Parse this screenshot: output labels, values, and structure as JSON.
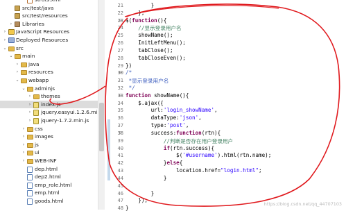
{
  "tree": {
    "items": [
      {
        "label": "struts.xml",
        "icon": "xml-file-icon",
        "indent": 3,
        "toggle": ""
      },
      {
        "label": "src/test/java",
        "icon": "package-folder-icon",
        "indent": 1,
        "toggle": ""
      },
      {
        "label": "src/test/resources",
        "icon": "package-folder-icon",
        "indent": 1,
        "toggle": ""
      },
      {
        "label": "Libraries",
        "icon": "library-icon",
        "indent": 1,
        "toggle": "›"
      },
      {
        "label": "JavaScript Resources",
        "icon": "javascript-resources-icon",
        "indent": 0,
        "toggle": "›"
      },
      {
        "label": "Deployed Resources",
        "icon": "deployed-resources-icon",
        "indent": 0,
        "toggle": "›"
      },
      {
        "label": "src",
        "icon": "folder-icon",
        "indent": 0,
        "toggle": "⌄"
      },
      {
        "label": "main",
        "icon": "folder-icon",
        "indent": 1,
        "toggle": "⌄"
      },
      {
        "label": "java",
        "icon": "folder-icon",
        "indent": 2,
        "toggle": "›"
      },
      {
        "label": "resources",
        "icon": "folder-icon",
        "indent": 2,
        "toggle": "›"
      },
      {
        "label": "webapp",
        "icon": "folder-icon",
        "indent": 2,
        "toggle": "⌄"
      },
      {
        "label": "adminjs",
        "icon": "folder-icon",
        "indent": 3,
        "toggle": "⌄"
      },
      {
        "label": "themes",
        "icon": "folder-icon",
        "indent": 4,
        "toggle": "›"
      },
      {
        "label": "index.js",
        "icon": "javascript-file-icon",
        "indent": 4,
        "toggle": "›",
        "selected": true
      },
      {
        "label": "jquery.easyui.1.2.6.min.js",
        "icon": "javascript-file-icon",
        "indent": 4,
        "toggle": "›"
      },
      {
        "label": "jquery-1.7.2.min.js",
        "icon": "javascript-file-icon",
        "indent": 4,
        "toggle": "›"
      },
      {
        "label": "css",
        "icon": "folder-icon",
        "indent": 3,
        "toggle": "›"
      },
      {
        "label": "images",
        "icon": "folder-icon",
        "indent": 3,
        "toggle": "›"
      },
      {
        "label": "js",
        "icon": "folder-icon",
        "indent": 3,
        "toggle": "›"
      },
      {
        "label": "ui",
        "icon": "folder-icon",
        "indent": 3,
        "toggle": "›"
      },
      {
        "label": "WEB-INF",
        "icon": "folder-icon",
        "indent": 3,
        "toggle": "›"
      },
      {
        "label": "dep.html",
        "icon": "html-file-icon",
        "indent": 3,
        "toggle": ""
      },
      {
        "label": "dep2.html",
        "icon": "html-file-icon",
        "indent": 3,
        "toggle": ""
      },
      {
        "label": "emp_role.html",
        "icon": "html-file-icon",
        "indent": 3,
        "toggle": ""
      },
      {
        "label": "emp.html",
        "icon": "html-file-icon",
        "indent": 3,
        "toggle": ""
      },
      {
        "label": "goods.html",
        "icon": "html-file-icon",
        "indent": 3,
        "toggle": ""
      }
    ]
  },
  "editor": {
    "lines": [
      {
        "n": "21",
        "fold": "",
        "tokens": [
          [
            "",
            "        }"
          ]
        ]
      },
      {
        "n": "22",
        "fold": "",
        "tokens": [
          [
            "",
            "    };"
          ]
        ]
      },
      {
        "n": "23",
        "fold": "⊖",
        "tokens": [
          [
            "",
            "$("
          ],
          [
            "kw",
            "function"
          ],
          [
            "",
            "(){"
          ]
        ]
      },
      {
        "n": "24",
        "fold": "",
        "tokens": [
          [
            "cm",
            "    //显示登录用户名"
          ]
        ]
      },
      {
        "n": "25",
        "fold": "",
        "tokens": [
          [
            "",
            "    showName();"
          ]
        ]
      },
      {
        "n": "26",
        "fold": "",
        "tokens": [
          [
            "",
            "    InitLeftMenu();"
          ]
        ]
      },
      {
        "n": "27",
        "fold": "",
        "tokens": [
          [
            "",
            "    tabClose();"
          ]
        ]
      },
      {
        "n": "28",
        "fold": "",
        "tokens": [
          [
            "",
            "    tabCloseEven();"
          ]
        ]
      },
      {
        "n": "29",
        "fold": "",
        "tokens": [
          [
            "",
            "})"
          ]
        ]
      },
      {
        "n": "30",
        "fold": "⊖",
        "tokens": [
          [
            "cm-doc",
            "/*"
          ]
        ]
      },
      {
        "n": "31",
        "fold": "",
        "tokens": [
          [
            "cm-doc",
            " *显示登录用户名"
          ]
        ]
      },
      {
        "n": "32",
        "fold": "",
        "tokens": [
          [
            "cm-doc",
            " */"
          ]
        ]
      },
      {
        "n": "33",
        "fold": "⊖",
        "tokens": [
          [
            "kw",
            "function"
          ],
          [
            "",
            " showName(){"
          ]
        ]
      },
      {
        "n": "34",
        "fold": "",
        "tokens": [
          [
            "",
            "    $.ajax({"
          ]
        ]
      },
      {
        "n": "35",
        "fold": "",
        "tokens": [
          [
            "",
            "        url:"
          ],
          [
            "str",
            "'login_showName'"
          ],
          [
            "",
            ","
          ]
        ]
      },
      {
        "n": "36",
        "fold": "",
        "tokens": [
          [
            "",
            "        dataType:"
          ],
          [
            "str",
            "'json'"
          ],
          [
            "",
            ","
          ]
        ]
      },
      {
        "n": "37",
        "fold": "",
        "tokens": [
          [
            "",
            "        type:"
          ],
          [
            "str",
            "'post'"
          ],
          [
            "",
            ","
          ]
        ]
      },
      {
        "n": "38",
        "fold": "⊖",
        "tokens": [
          [
            "",
            "        success:"
          ],
          [
            "kw",
            "function"
          ],
          [
            "",
            "(rtn){"
          ]
        ]
      },
      {
        "n": "39",
        "fold": "",
        "tokens": [
          [
            "cm",
            "            //判断是否存在用户登录用户"
          ]
        ]
      },
      {
        "n": "40",
        "fold": "",
        "tokens": [
          [
            "",
            "            "
          ],
          [
            "kw",
            "if"
          ],
          [
            "",
            "(rtn.success){"
          ]
        ]
      },
      {
        "n": "41",
        "fold": "",
        "tokens": [
          [
            "",
            "                $("
          ],
          [
            "str",
            "'#username'"
          ],
          [
            "",
            ").html(rtn.name);"
          ]
        ]
      },
      {
        "n": "42",
        "fold": "",
        "tokens": [
          [
            "",
            "            }"
          ],
          [
            "kw",
            "else"
          ],
          [
            "",
            "{"
          ]
        ]
      },
      {
        "n": "43",
        "fold": "",
        "tokens": [
          [
            "",
            "                location.href="
          ],
          [
            "str",
            "\"login.html\""
          ],
          [
            "",
            ";"
          ]
        ]
      },
      {
        "n": "44",
        "fold": "",
        "tokens": [
          [
            "",
            "            }"
          ]
        ]
      },
      {
        "n": "45",
        "fold": "",
        "tokens": [
          [
            "",
            ""
          ]
        ]
      },
      {
        "n": "46",
        "fold": "",
        "tokens": [
          [
            "",
            "        }"
          ]
        ]
      },
      {
        "n": "47",
        "fold": "",
        "tokens": [
          [
            "",
            "    });"
          ]
        ]
      },
      {
        "n": "48",
        "fold": "",
        "tokens": [
          [
            "",
            "}"
          ]
        ]
      }
    ]
  },
  "watermark": "https://blog.csdn.net/qq_44707103",
  "colors": {
    "keyword": "#7f0055",
    "string": "#2a00ff",
    "comment": "#3f7f5f",
    "annotation": "#e0191d"
  }
}
